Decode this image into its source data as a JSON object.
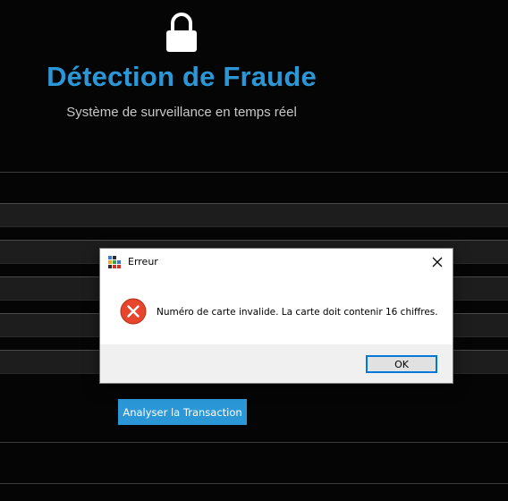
{
  "app": {
    "title": "Détection de Fraude",
    "subtitle": "Système de surveillance en temps réel",
    "lock_icon": "lock-icon",
    "analyze_button_label": "Analyser la Transaction",
    "accent_color": "#2b97d6",
    "background_color": "#050505"
  },
  "dialog": {
    "title": "Erreur",
    "message": "Numéro de carte invalide. La carte doit contenir 16 chiffres.",
    "ok_label": "OK",
    "icon": "error-icon",
    "error_color": "#e8462c"
  }
}
